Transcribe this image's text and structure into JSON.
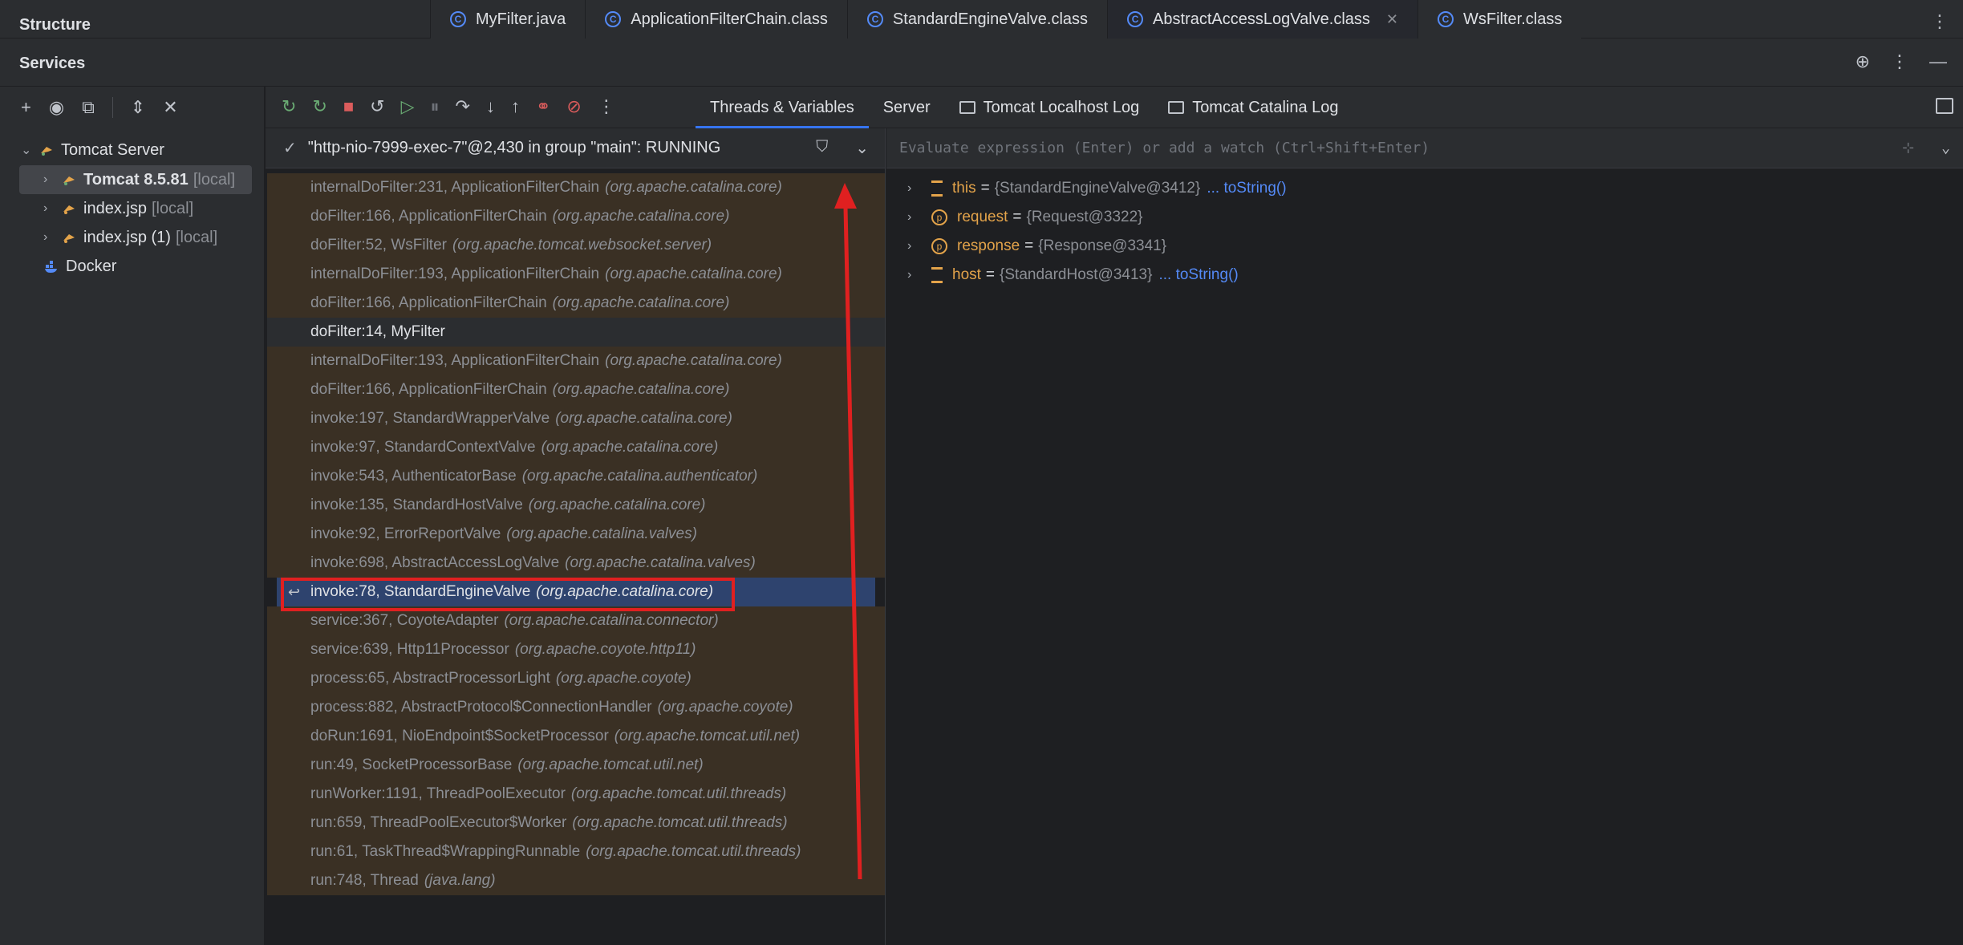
{
  "structure_title": "Structure",
  "editor_tabs": [
    {
      "label": "MyFilter.java",
      "active": false,
      "closable": false
    },
    {
      "label": "ApplicationFilterChain.class",
      "active": false,
      "closable": false
    },
    {
      "label": "StandardEngineValve.class",
      "active": false,
      "closable": false
    },
    {
      "label": "AbstractAccessLogValve.class",
      "active": true,
      "closable": true
    },
    {
      "label": "WsFilter.class",
      "active": false,
      "closable": false
    }
  ],
  "services": {
    "title": "Services"
  },
  "tree": {
    "tomcat_server": "Tomcat Server",
    "tomcat_instance": {
      "name": "Tomcat 8.5.81",
      "suffix": "[local]"
    },
    "index_jsp": {
      "name": "index.jsp",
      "suffix": "[local]"
    },
    "index_jsp_1": {
      "name": "index.jsp (1)",
      "suffix": "[local]"
    },
    "docker": "Docker"
  },
  "debug_tabs": [
    {
      "label": "Threads & Variables",
      "active": true
    },
    {
      "label": "Server",
      "active": false
    },
    {
      "label": "Tomcat Localhost Log",
      "active": false
    },
    {
      "label": "Tomcat Catalina Log",
      "active": false
    }
  ],
  "thread": {
    "label": "\"http-nio-7999-exec-7\"@2,430 in group \"main\": RUNNING"
  },
  "frames": [
    {
      "method": "internalDoFilter:231, ApplicationFilterChain",
      "pkg": "(org.apache.catalina.core)",
      "kind": "lib"
    },
    {
      "method": "doFilter:166, ApplicationFilterChain",
      "pkg": "(org.apache.catalina.core)",
      "kind": "lib"
    },
    {
      "method": "doFilter:52, WsFilter",
      "pkg": "(org.apache.tomcat.websocket.server)",
      "kind": "lib"
    },
    {
      "method": "internalDoFilter:193, ApplicationFilterChain",
      "pkg": "(org.apache.catalina.core)",
      "kind": "lib"
    },
    {
      "method": "doFilter:166, ApplicationFilterChain",
      "pkg": "(org.apache.catalina.core)",
      "kind": "lib"
    },
    {
      "method": "doFilter:14, MyFilter",
      "pkg": "",
      "kind": "plain"
    },
    {
      "method": "internalDoFilter:193, ApplicationFilterChain",
      "pkg": "(org.apache.catalina.core)",
      "kind": "lib"
    },
    {
      "method": "doFilter:166, ApplicationFilterChain",
      "pkg": "(org.apache.catalina.core)",
      "kind": "lib"
    },
    {
      "method": "invoke:197, StandardWrapperValve",
      "pkg": "(org.apache.catalina.core)",
      "kind": "lib"
    },
    {
      "method": "invoke:97, StandardContextValve",
      "pkg": "(org.apache.catalina.core)",
      "kind": "lib"
    },
    {
      "method": "invoke:543, AuthenticatorBase",
      "pkg": "(org.apache.catalina.authenticator)",
      "kind": "lib"
    },
    {
      "method": "invoke:135, StandardHostValve",
      "pkg": "(org.apache.catalina.core)",
      "kind": "lib"
    },
    {
      "method": "invoke:92, ErrorReportValve",
      "pkg": "(org.apache.catalina.valves)",
      "kind": "lib"
    },
    {
      "method": "invoke:698, AbstractAccessLogValve",
      "pkg": "(org.apache.catalina.valves)",
      "kind": "lib"
    },
    {
      "method": "invoke:78, StandardEngineValve",
      "pkg": "(org.apache.catalina.core)",
      "kind": "current"
    },
    {
      "method": "service:367, CoyoteAdapter",
      "pkg": "(org.apache.catalina.connector)",
      "kind": "lib"
    },
    {
      "method": "service:639, Http11Processor",
      "pkg": "(org.apache.coyote.http11)",
      "kind": "lib"
    },
    {
      "method": "process:65, AbstractProcessorLight",
      "pkg": "(org.apache.coyote)",
      "kind": "lib"
    },
    {
      "method": "process:882, AbstractProtocol$ConnectionHandler",
      "pkg": "(org.apache.coyote)",
      "kind": "lib"
    },
    {
      "method": "doRun:1691, NioEndpoint$SocketProcessor",
      "pkg": "(org.apache.tomcat.util.net)",
      "kind": "lib"
    },
    {
      "method": "run:49, SocketProcessorBase",
      "pkg": "(org.apache.tomcat.util.net)",
      "kind": "lib"
    },
    {
      "method": "runWorker:1191, ThreadPoolExecutor",
      "pkg": "(org.apache.tomcat.util.threads)",
      "kind": "lib"
    },
    {
      "method": "run:659, ThreadPoolExecutor$Worker",
      "pkg": "(org.apache.tomcat.util.threads)",
      "kind": "lib"
    },
    {
      "method": "run:61, TaskThread$WrappingRunnable",
      "pkg": "(org.apache.tomcat.util.threads)",
      "kind": "lib"
    },
    {
      "method": "run:748, Thread",
      "pkg": "(java.lang)",
      "kind": "lib"
    }
  ],
  "evaluate": {
    "placeholder": "Evaluate expression (Enter) or add a watch (Ctrl+Shift+Enter)"
  },
  "variables": [
    {
      "name": "this",
      "value": "{StandardEngineValve@3412}",
      "link": "... toString()",
      "icon": "stack"
    },
    {
      "name": "request",
      "value": "{Request@3322}",
      "link": "",
      "icon": "param"
    },
    {
      "name": "response",
      "value": "{Response@3341}",
      "link": "",
      "icon": "param"
    },
    {
      "name": "host",
      "value": "{StandardHost@3413}",
      "link": "... toString()",
      "icon": "stack"
    }
  ],
  "colors": {
    "accent": "#3574f0",
    "lib_frame_bg": "#3a3024",
    "current_frame_bg": "#2e436e",
    "annotation_red": "#e02020",
    "var_name": "#e3a34a"
  }
}
